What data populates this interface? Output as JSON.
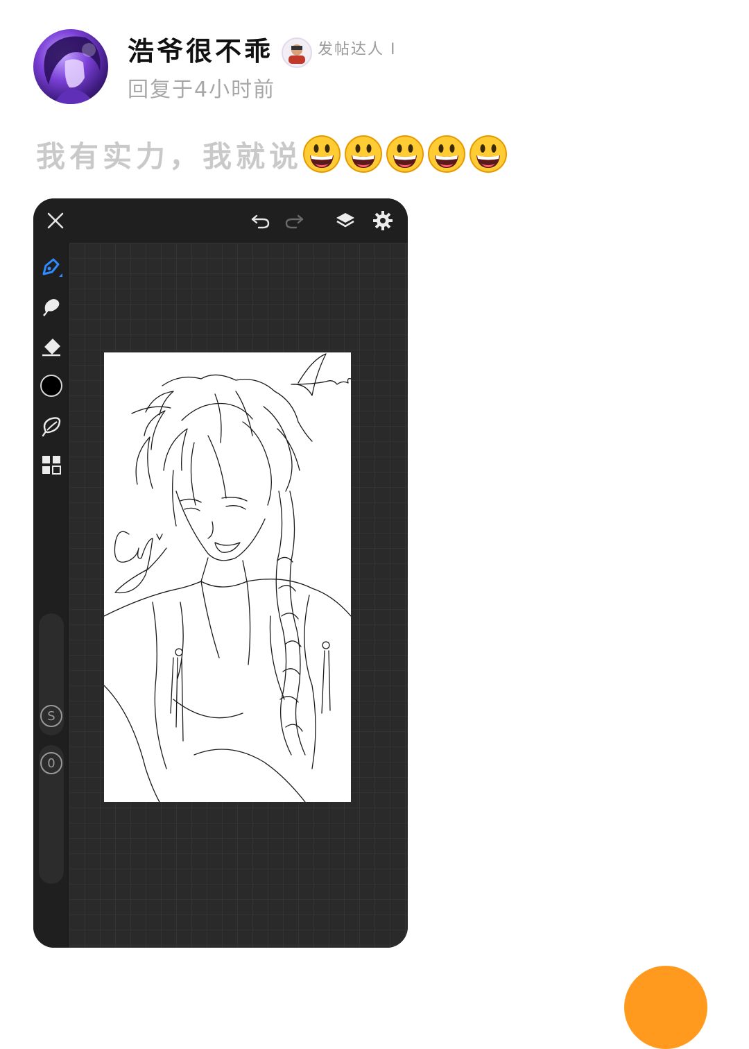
{
  "post": {
    "username": "浩爷很不乖",
    "badge_text": "发帖达人 I",
    "reply_time": "回复于4小时前",
    "content": "我有实力，我就说",
    "emoji_count": 5
  },
  "drawing_app": {
    "toolbar_icons": [
      "close-icon",
      "undo-icon",
      "redo-icon",
      "layers-icon",
      "settings-icon"
    ],
    "sidebar_tools": [
      "pen-icon",
      "smudge-icon",
      "eraser-icon",
      "color-swatch",
      "lasso-icon",
      "grid-icon"
    ],
    "brush_size_label": "S",
    "opacity_label": "0",
    "active_color": "#000000",
    "accent_color": "#2f8cff"
  }
}
